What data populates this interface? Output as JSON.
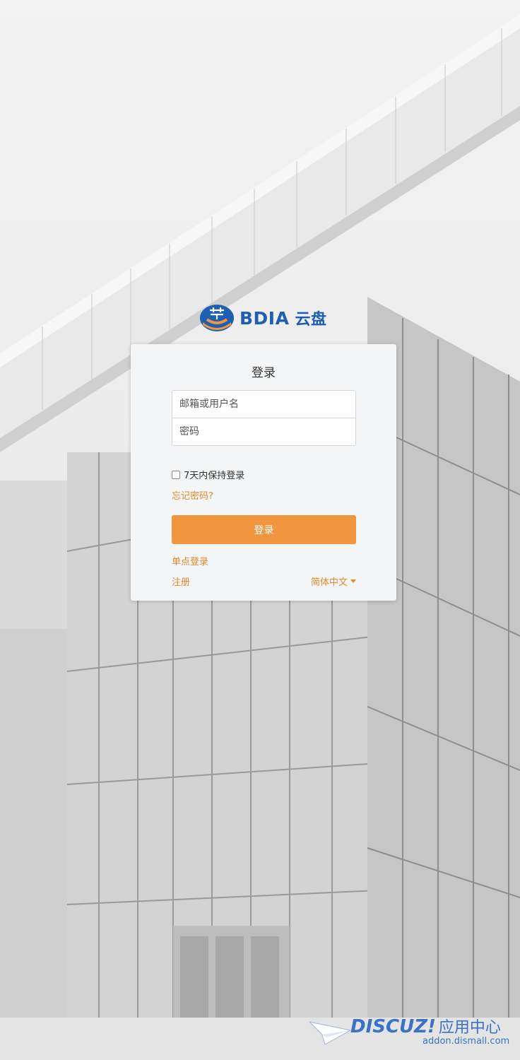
{
  "logo": {
    "brand": "BDIA",
    "product": "云盘",
    "icon": "bdia-logo-icon"
  },
  "login_card": {
    "title": "登录",
    "username_placeholder": "邮箱或用户名",
    "password_placeholder": "密码",
    "remember_label": "7天内保持登录",
    "forgot_label": "忘记密码?",
    "submit_label": "登录",
    "sso_label": "单点登录",
    "register_label": "注册",
    "language_label": "简体中文"
  },
  "watermark": {
    "brand": "DISCUZ!",
    "cn": "应用中心",
    "url": "addon.dismall.com"
  },
  "colors": {
    "accent": "#f0963f",
    "link": "#e28a2b",
    "brand_blue": "#1e5fb4"
  }
}
